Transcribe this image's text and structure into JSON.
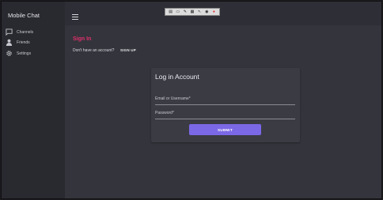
{
  "app": {
    "title": "Mobile Chat"
  },
  "sidebar": {
    "items": [
      {
        "label": "Channels",
        "icon": "chat-icon"
      },
      {
        "label": "Friends",
        "icon": "friends-icon"
      },
      {
        "label": "Settings",
        "icon": "gear-icon"
      }
    ]
  },
  "toolbar": {
    "icons": [
      "doc-icon",
      "video-icon",
      "pen-icon",
      "grid-icon",
      "cursor-icon",
      "record-icon",
      "close-icon"
    ]
  },
  "page": {
    "heading": "Sign In",
    "no_account_text": "Don't have an account?",
    "signup_label": "SIGN UP"
  },
  "login": {
    "title": "Log in Account",
    "email_label": "Email or Username*",
    "password_label": "Password*",
    "submit_label": "SUBMIT"
  },
  "colors": {
    "accent": "#7b68e6",
    "heading": "#e0306a",
    "background": "#34343c",
    "sidebar": "#292930"
  }
}
